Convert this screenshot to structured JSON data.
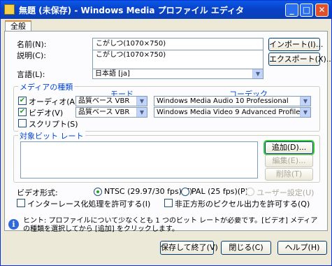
{
  "window": {
    "title": "無題 (未保存) - Windows Media プロファイル エディタ",
    "minimize": "_",
    "maximize": "□",
    "close": "✕"
  },
  "tabs": [
    {
      "label": "全般"
    }
  ],
  "form": {
    "name_label": "名前(N):",
    "name_value": "こがしつ(1070×750)",
    "desc_label": "説明(C):",
    "desc_value": "こがしつ(1070×750)",
    "lang_label": "言語(L):",
    "lang_value": "日本語 [ja]",
    "import_button": "インポート(I)...",
    "export_button": "エクスポート(X)..."
  },
  "media": {
    "group_label": "メディアの種類",
    "mode_header": "モード",
    "codec_header": "コーデック",
    "audio_label": "オーディオ(A)",
    "audio_checked": true,
    "audio_mode": "品質ベース VBR",
    "audio_codec": "Windows Media Audio 10 Professional",
    "video_label": "ビデオ(V)",
    "video_checked": true,
    "video_mode": "品質ベース VBR",
    "video_codec": "Windows Media Video 9 Advanced Profile",
    "script_label": "スクリプト(S)",
    "script_checked": false
  },
  "bitrate": {
    "group_label": "対象ビット レート",
    "add_button": "追加(D)...",
    "edit_button": "編集(E)...",
    "delete_button": "削除(T)"
  },
  "video_format": {
    "label": "ビデオ形式:",
    "ntsc_label": "NTSC (29.97/30 fps)(T)",
    "ntsc_selected": true,
    "pal_label": "PAL (25 fps)(P)",
    "pal_selected": false,
    "user_label": "ユーザー設定(U)",
    "user_selected": false,
    "interlace_label": "インターレース化処理を許可する(I)",
    "interlace_checked": false,
    "nonsquare_label": "非正方形のピクセル出力を許可する(Q)",
    "nonsquare_checked": false
  },
  "info_text": "ヒント: プロファイルについて少なくとも 1 つのビット レートが必要です。[ビデオ] メディアの種類を選択してから [追加] をクリックします。",
  "footer": {
    "save_button": "保存して終了(V)",
    "close_button": "閉じる(C)",
    "help_button": "ヘルプ(H)"
  }
}
